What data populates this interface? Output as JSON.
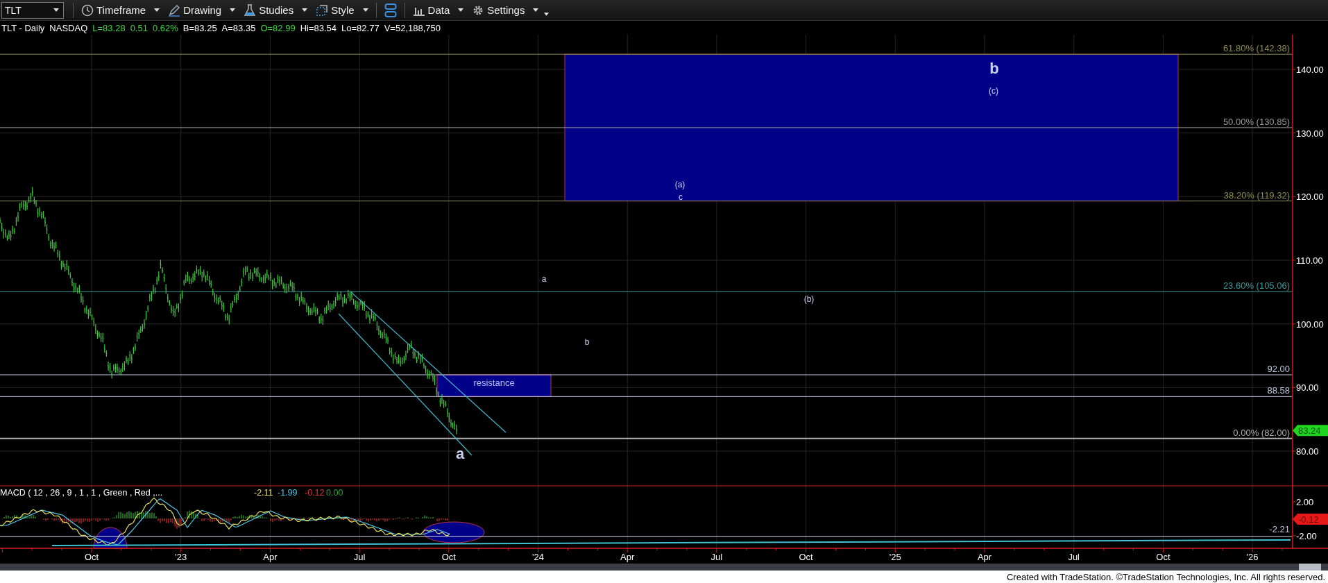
{
  "toolbar": {
    "symbol": "TLT",
    "menus": [
      {
        "label": "Timeframe",
        "kind": "timeframe"
      },
      {
        "label": "Drawing",
        "kind": "drawing"
      },
      {
        "label": "Studies",
        "kind": "studies"
      },
      {
        "label": "Style",
        "kind": "style"
      },
      {
        "kind": "layout"
      },
      {
        "label": "Data",
        "kind": "data"
      },
      {
        "label": "Settings",
        "kind": "settings"
      }
    ]
  },
  "quote_line": [
    {
      "text": "TLT - Daily",
      "color": "#ffffff"
    },
    {
      "text": "NASDAQ",
      "color": "#ffffff"
    },
    {
      "text": "L=83.28",
      "color": "#3ed43e"
    },
    {
      "text": "0.51",
      "color": "#3ed43e"
    },
    {
      "text": "0.62%",
      "color": "#3ed43e"
    },
    {
      "text": "B=83.25",
      "color": "#ffffff"
    },
    {
      "text": "A=83.35",
      "color": "#ffffff"
    },
    {
      "text": "O=82.99",
      "color": "#3ed43e"
    },
    {
      "text": "Hi=83.54",
      "color": "#ffffff"
    },
    {
      "text": "Lo=82.77",
      "color": "#ffffff"
    },
    {
      "text": "V=52,188,750",
      "color": "#ffffff"
    }
  ],
  "price_chart": {
    "price_axis": [
      "140.00",
      "130.00",
      "120.00",
      "110.00",
      "100.00",
      "90.00",
      "80.00"
    ],
    "last_price": "83.24",
    "levels": [
      {
        "label": "61.80% (142.38)",
        "color": "#8c8c50"
      },
      {
        "label": "50.00% (130.85)",
        "color": "#9a9a9a"
      },
      {
        "label": "38.20% (119.32)",
        "color": "#8c8c50"
      },
      {
        "label": "23.60% (105.06)",
        "color": "#3f9a9a"
      },
      {
        "label": "92.00",
        "color": "#c0c8e0"
      },
      {
        "label": "88.58",
        "color": "#c0c8e0"
      },
      {
        "label": "0.00% (82.00)",
        "color": "#b0b0b0"
      }
    ],
    "resistance_zone": {
      "label": "resistance"
    },
    "wave_labels": [
      {
        "text": "b",
        "kind": "major"
      },
      {
        "text": "(c)",
        "kind": "minor"
      },
      {
        "text": "(a)",
        "kind": "minor"
      },
      {
        "text": "c",
        "kind": "minor"
      },
      {
        "text": "a",
        "kind": "minor"
      },
      {
        "text": "(b)",
        "kind": "minor"
      },
      {
        "text": "b",
        "kind": "minor"
      },
      {
        "text": "a",
        "kind": "major"
      }
    ]
  },
  "macd": {
    "title": "MACD ( 12 , 26 , 9 , 1 , 1 , Green , Red ,...",
    "values": [
      {
        "text": "-2.11",
        "color": "#e8e060"
      },
      {
        "text": "-1.99",
        "color": "#50c8e8"
      },
      {
        "text": "-0.12",
        "color": "#e83030"
      },
      {
        "text": "0.00",
        "color": "#30a030"
      }
    ],
    "axis": [
      "2.00",
      "-2.00"
    ],
    "last_value": "-0.12",
    "level_label": "-2.21"
  },
  "time_axis": [
    "Oct",
    "'23",
    "Apr",
    "Jul",
    "Oct",
    "'24",
    "Apr",
    "Jul",
    "Oct",
    "'25",
    "Apr",
    "Jul",
    "Oct",
    "'26"
  ],
  "footer": "Created with TradeStation. ©TradeStation Technologies, Inc. All rights reserved."
}
